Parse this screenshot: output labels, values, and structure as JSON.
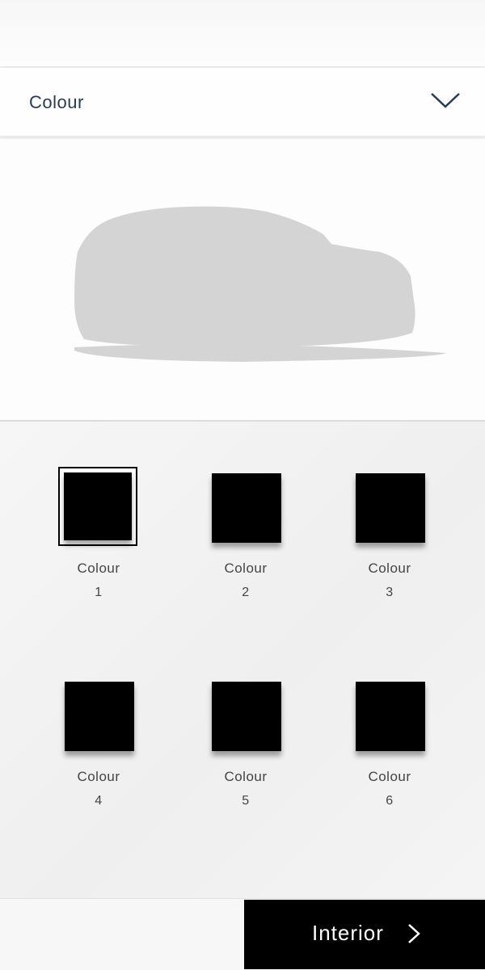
{
  "header": {
    "section_title": "Colour",
    "expand_icon": "chevron-down-icon"
  },
  "preview": {
    "image": "car-silhouette",
    "color": "#d4d4d4"
  },
  "swatches": [
    {
      "label": "Colour",
      "number": "1",
      "color": "#000000",
      "selected": true
    },
    {
      "label": "Colour",
      "number": "2",
      "color": "#000000",
      "selected": false
    },
    {
      "label": "Colour",
      "number": "3",
      "color": "#000000",
      "selected": false
    },
    {
      "label": "Colour",
      "number": "4",
      "color": "#000000",
      "selected": false
    },
    {
      "label": "Colour",
      "number": "5",
      "color": "#000000",
      "selected": false
    },
    {
      "label": "Colour",
      "number": "6",
      "color": "#000000",
      "selected": false
    }
  ],
  "footer": {
    "next_label": "Interior",
    "next_icon": "chevron-right-icon"
  },
  "colors": {
    "header_text": "#2b3a55",
    "button_bg": "#000000",
    "button_text": "#ffffff"
  }
}
